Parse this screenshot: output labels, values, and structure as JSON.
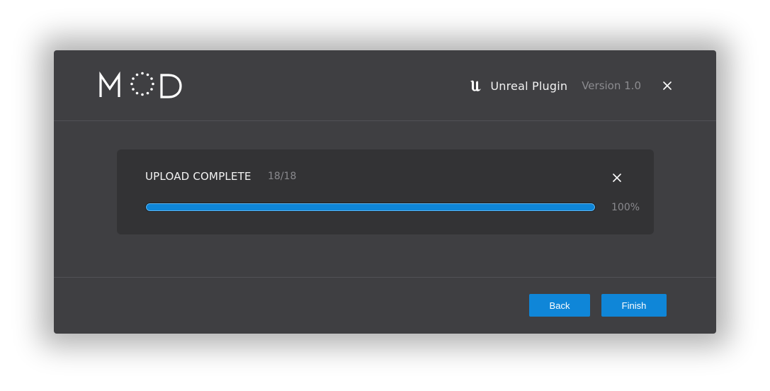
{
  "header": {
    "logo_text": "MOD",
    "plugin_icon": "unreal-engine-icon",
    "plugin_name": "Unreal Plugin",
    "version": "Version 1.0",
    "close_icon": "close-icon"
  },
  "upload": {
    "status": "UPLOAD COMPLETE",
    "count": "18/18",
    "progress": 1.0,
    "percent_label": "100%",
    "close_icon": "close-icon"
  },
  "footer": {
    "back_label": "Back",
    "finish_label": "Finish"
  },
  "colors": {
    "dialog_bg": "#3f3f42",
    "panel_bg": "#333335",
    "accent": "#0f86d8",
    "muted_text": "#8a8a8e"
  }
}
